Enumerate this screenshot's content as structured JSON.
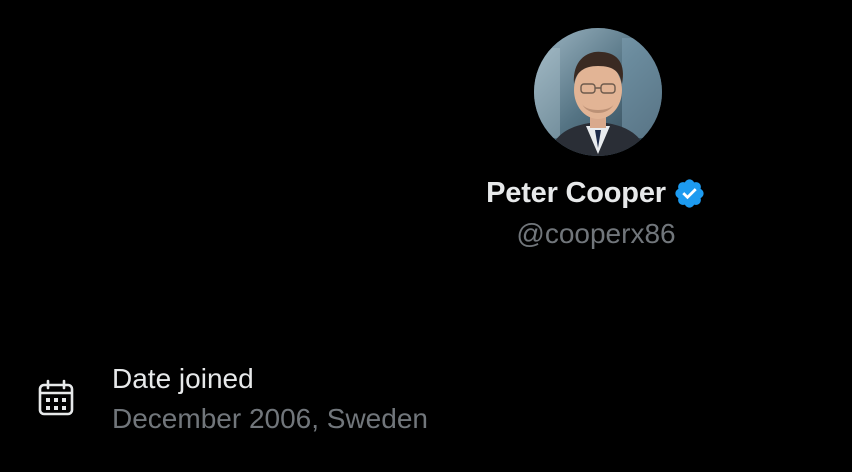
{
  "profile": {
    "display_name": "Peter Cooper",
    "handle": "@cooperx86",
    "avatar_icon": "profile-photo",
    "verified_icon": "verified-badge-icon",
    "verified_color": "#1d9bf0"
  },
  "joined": {
    "label": "Date joined",
    "value": "December 2006, Sweden",
    "icon": "calendar-icon"
  },
  "colors": {
    "background": "#000000",
    "primary_text": "#e7e9ea",
    "secondary_text": "#71767b"
  }
}
